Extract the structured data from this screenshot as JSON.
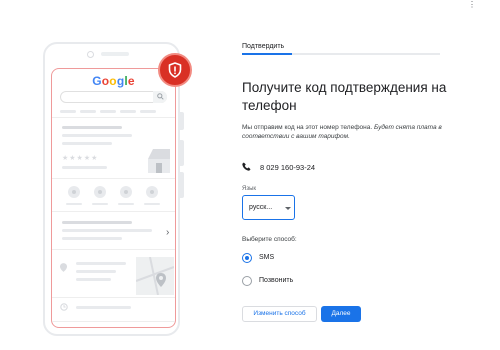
{
  "top_menu": {
    "icon": "dots-menu-icon"
  },
  "illustration": {
    "brand_letters": [
      {
        "ch": "G",
        "color": "#4285F4"
      },
      {
        "ch": "o",
        "color": "#EA4335"
      },
      {
        "ch": "o",
        "color": "#FBBC05"
      },
      {
        "ch": "g",
        "color": "#4285F4"
      },
      {
        "ch": "l",
        "color": "#34A853"
      },
      {
        "ch": "e",
        "color": "#EA4335"
      }
    ],
    "rating_stars": "★★★★★",
    "badge_icon": "shield-alert-icon",
    "badge_color": "#d93025"
  },
  "stepper": {
    "tab_label": "Подтвердить"
  },
  "main": {
    "title": "Получите код подтверждения на телефон",
    "description_plain": "Мы отправим код на этот номер телефона. ",
    "description_italic": "Будет снята плата в соответствии с вашим тарифом.",
    "phone_icon": "phone-icon",
    "phone_number": "8 029 160-93-24",
    "language_label": "Язык",
    "language_value": "русск...",
    "method_label": "Выберите способ:",
    "options": [
      {
        "label": "SMS",
        "selected": true
      },
      {
        "label": "Позвонить",
        "selected": false
      }
    ]
  },
  "actions": {
    "change_method": "Изменить способ",
    "next": "Далее"
  },
  "colors": {
    "accent": "#1a73e8",
    "badge": "#d93025",
    "text": "#202124"
  }
}
